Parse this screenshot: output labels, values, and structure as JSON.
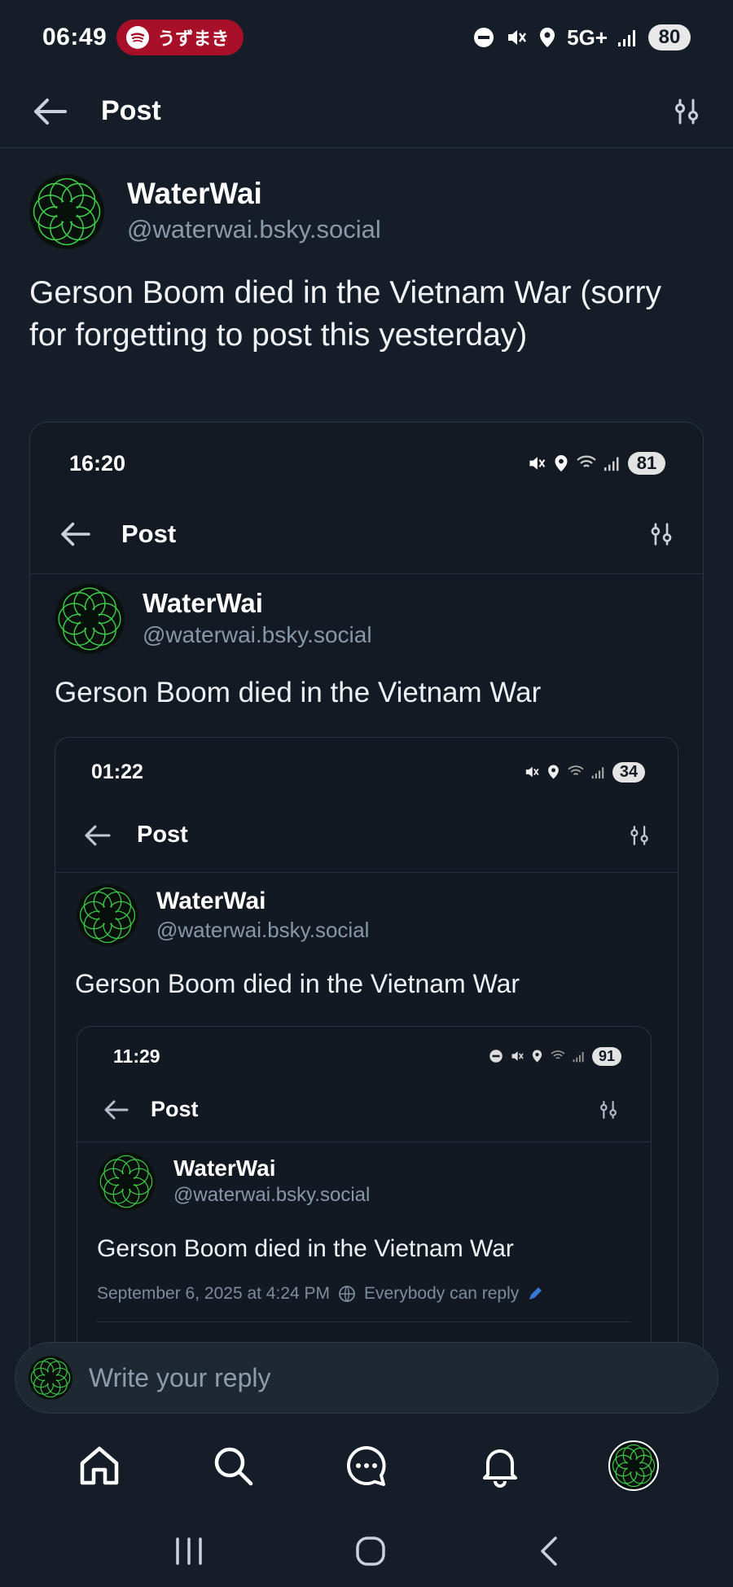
{
  "status_bar": {
    "time": "06:49",
    "media_app": "spotify-icon",
    "media_title": "うずまき",
    "network": "5G+",
    "battery": "80"
  },
  "header": {
    "back_icon": "back-arrow-icon",
    "title": "Post",
    "filter_icon": "sliders-icon"
  },
  "post": {
    "author_name": "WaterWai",
    "author_handle": "@waterwai.bsky.social",
    "text": "Gerson Boom died in the Vietnam War (sorry for forgetting to post this yesterday)"
  },
  "embed_1": {
    "time": "16:20",
    "battery": "81",
    "header_title": "Post",
    "author_name": "WaterWai",
    "author_handle": "@waterwai.bsky.social",
    "text": "Gerson Boom died in the Vietnam War"
  },
  "embed_2": {
    "time": "01:22",
    "battery": "34",
    "header_title": "Post",
    "author_name": "WaterWai",
    "author_handle": "@waterwai.bsky.social",
    "text": "Gerson Boom died in the Vietnam War"
  },
  "embed_3": {
    "time": "11:29",
    "battery": "91",
    "header_title": "Post",
    "author_name": "WaterWai",
    "author_handle": "@waterwai.bsky.social",
    "text": "Gerson Boom died in the Vietnam War",
    "timestamp": "September 6, 2025 at 4:24 PM",
    "reply_setting": "Everybody can reply"
  },
  "reply_bar": {
    "placeholder": "Write your reply"
  },
  "tabbar": {
    "items": [
      "home-icon",
      "search-icon",
      "chat-icon",
      "bell-icon",
      "profile-avatar"
    ]
  },
  "system_nav": {
    "items": [
      "recents-icon",
      "home-circle-icon",
      "back-chevron-icon"
    ]
  },
  "colors": {
    "background": "#151d28",
    "spotify_pill": "#a8102a",
    "avatar_green": "#3fd24a",
    "muted_text": "#8b98a8"
  }
}
